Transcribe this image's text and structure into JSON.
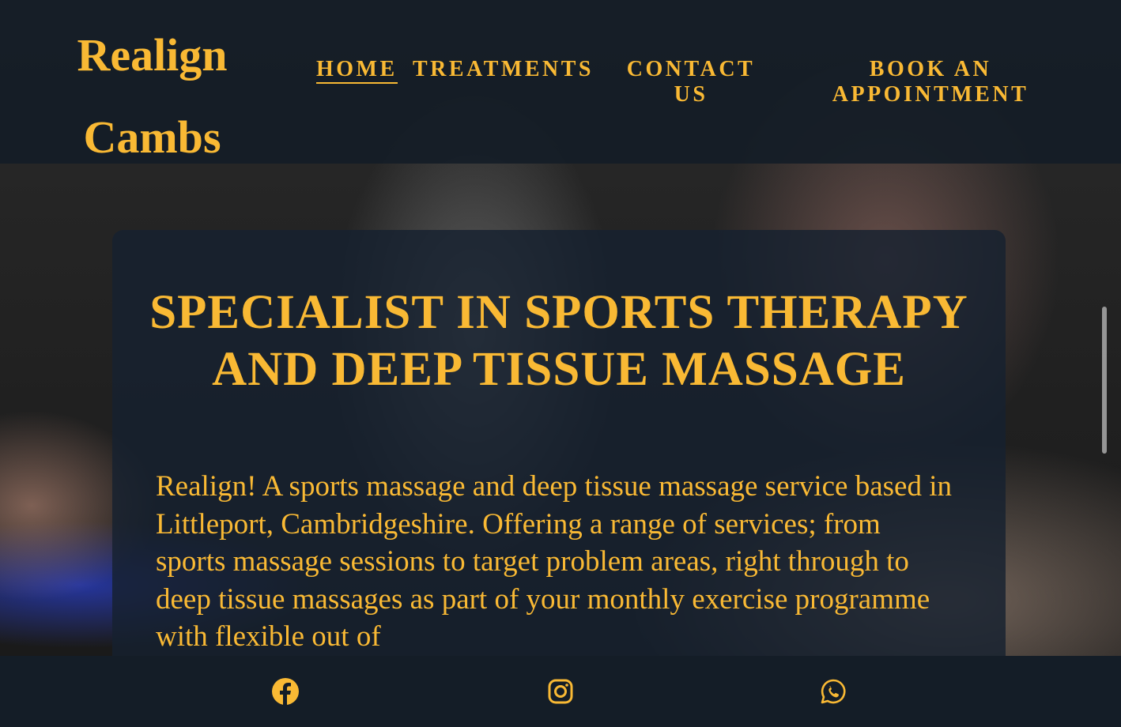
{
  "brand": {
    "line1": "Realign",
    "line2": "Cambs"
  },
  "nav": [
    {
      "label": "HOME",
      "active": true
    },
    {
      "label": "TREATMENTS"
    },
    {
      "label": "CONTACT US"
    },
    {
      "label": "BOOK AN APPOINTMENT"
    }
  ],
  "hero": {
    "heading": "SPECIALIST IN SPORTS THERAPY AND DEEP TISSUE MASSAGE",
    "intro": "Realign! A sports massage and deep tissue massage service based in Littleport, Cambridgeshire. Offering a range of services; from sports massage sessions to target problem areas, right through to deep tissue massages as part of your monthly exercise programme with flexible out of"
  },
  "footer": {
    "icons": [
      "facebook-icon",
      "instagram-icon",
      "whatsapp-icon"
    ]
  },
  "colors": {
    "accent": "#f9b934",
    "background": "#141d27"
  }
}
